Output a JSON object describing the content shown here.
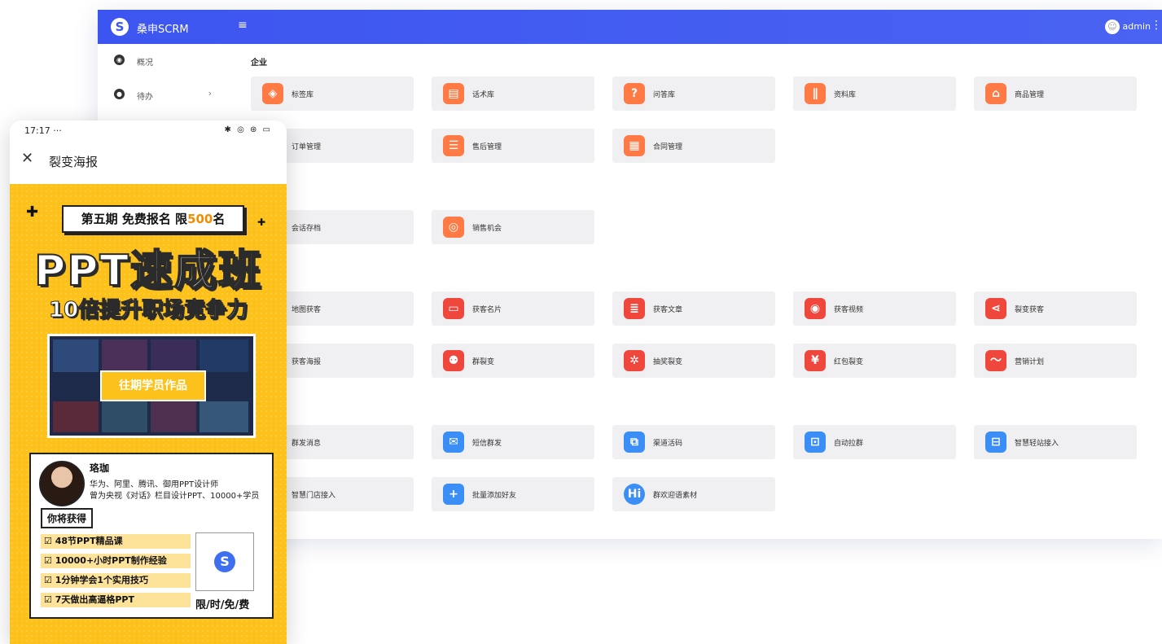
{
  "app": {
    "brand": "桑申SCRM",
    "menu_icon": "menu-icon",
    "username": "admin",
    "accent_color": "#3d55f0"
  },
  "sidebar": {
    "items": [
      {
        "label": "概况",
        "icon": "dashboard-icon"
      },
      {
        "label": "待办",
        "icon": "todo-icon",
        "chevron": "›"
      }
    ]
  },
  "sections": [
    {
      "title": "企业",
      "rows": [
        [
          "标签库",
          "话术库",
          "问答库",
          "资料库",
          "商品管理"
        ],
        [
          "订单管理",
          "售后管理",
          "合同管理"
        ]
      ]
    },
    {
      "title": "",
      "rows": [
        [
          "会话存档",
          "销售机会"
        ]
      ]
    },
    {
      "title": "",
      "rows": [
        [
          "地图获客",
          "获客名片",
          "获客文章",
          "获客视频",
          "裂变获客"
        ],
        [
          "获客海报",
          "群裂变",
          "抽奖裂变",
          "红包裂变",
          "营销计划"
        ]
      ]
    },
    {
      "title": "",
      "rows": [
        [
          "群发消息",
          "短信群发",
          "渠道活码",
          "自动拉群",
          "智慧轻站接入"
        ],
        [
          "智慧门店接入",
          "批量添加好友",
          "群欢迎语素材"
        ]
      ]
    }
  ],
  "phone": {
    "status_time": "17:17 ···",
    "status_icons": "✱ ◎ ⊛ ▭",
    "title": "裂变海报",
    "close_icon": "close-icon"
  },
  "poster": {
    "badge_text": "第五期 免费报名 限",
    "badge_num": "500",
    "badge_suffix": "名",
    "title": "PPT速成班",
    "subtitle": "10倍提升职场竞争力",
    "showcase_label": "往期学员作品",
    "teacher_name": "珞珈",
    "teacher_bio_1": "华为、阿里、腾讯、御用PPT设计师",
    "teacher_bio_2": "曾为央视《对话》栏目设计PPT、10000+学员",
    "gain_label": "你将获得",
    "benefits": [
      "☑ 48节PPT精品课",
      "☑ 10000+小时PPT制作经验",
      "☑ 1分钟学会1个实用技巧",
      "☑ 7天做出高逼格PPT"
    ],
    "qr_caption": "限/时/免/费"
  }
}
